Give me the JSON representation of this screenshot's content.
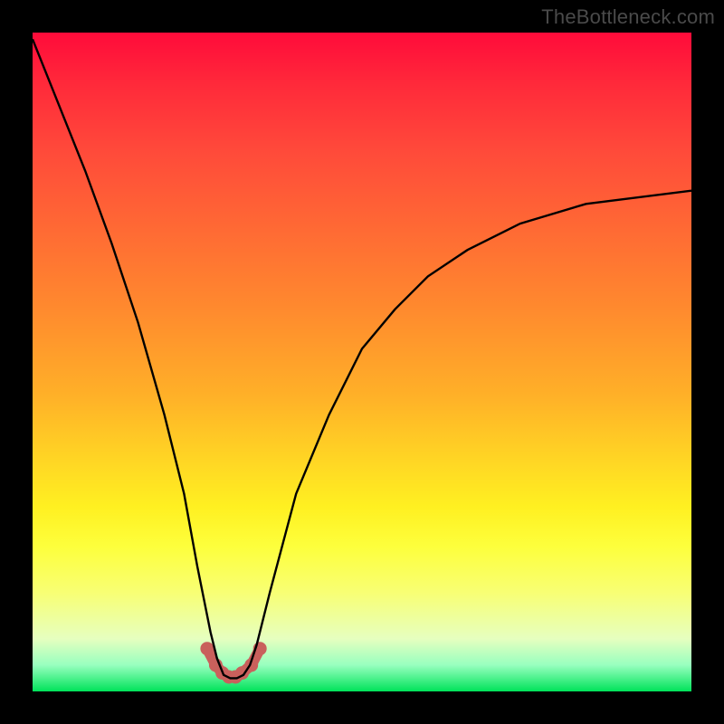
{
  "watermark": "TheBottleneck.com",
  "colors": {
    "frame": "#000000",
    "gradient_top": "#ff0b3a",
    "gradient_bottom": "#00e35a",
    "curve": "#000000",
    "marker": "#c9605c"
  },
  "chart_data": {
    "type": "line",
    "title": "",
    "xlabel": "",
    "ylabel": "",
    "xlim": [
      0,
      100
    ],
    "ylim": [
      0,
      100
    ],
    "grid": false,
    "legend": false,
    "series": [
      {
        "name": "curve",
        "x": [
          0,
          4,
          8,
          12,
          16,
          20,
          23,
          25,
          27,
          28,
          29,
          30,
          31,
          32,
          33,
          34,
          36,
          40,
          45,
          50,
          55,
          60,
          66,
          74,
          84,
          100
        ],
        "y": [
          99,
          89,
          79,
          68,
          56,
          42,
          30,
          19,
          9,
          5,
          2.5,
          2,
          2,
          2.5,
          4,
          7,
          15,
          30,
          42,
          52,
          58,
          63,
          67,
          71,
          74,
          76
        ]
      }
    ],
    "markers": {
      "name": "bottom-highlight",
      "x": [
        26.5,
        27.8,
        28.8,
        29.8,
        30.8,
        31.8,
        33.2,
        34.5
      ],
      "y": [
        6.5,
        4.0,
        2.8,
        2.2,
        2.2,
        2.8,
        4.0,
        6.5
      ]
    }
  }
}
